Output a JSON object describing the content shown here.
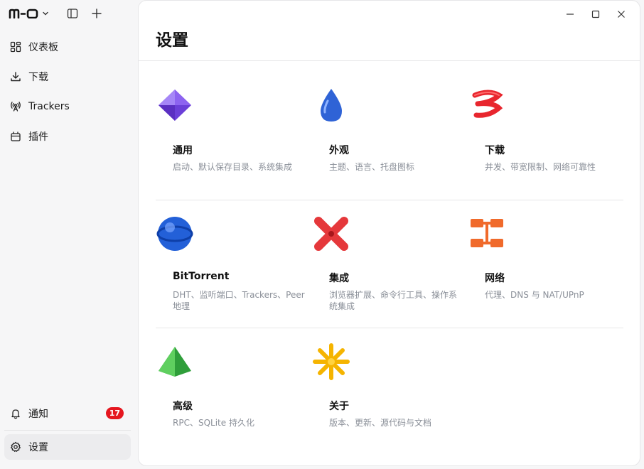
{
  "app": {
    "logo_text": "m-o"
  },
  "sidebar": {
    "items": [
      {
        "label": "仪表板",
        "icon": "dashboard-icon"
      },
      {
        "label": "下载",
        "icon": "download-icon"
      },
      {
        "label": "Trackers",
        "icon": "antenna-icon"
      },
      {
        "label": "插件",
        "icon": "plugin-icon"
      }
    ],
    "notifications": {
      "label": "通知",
      "icon": "bell-icon",
      "count": "17"
    },
    "settings": {
      "label": "设置",
      "icon": "gear-icon"
    }
  },
  "main": {
    "title": "设置",
    "cards": [
      {
        "title": "通用",
        "desc": "启动、默认保存目录、系统集成",
        "icon": "purple-gem-icon"
      },
      {
        "title": "外观",
        "desc": "主题、语言、托盘图标",
        "icon": "blue-drop-icon"
      },
      {
        "title": "下载",
        "desc": "并发、带宽限制、网络可靠性",
        "icon": "red-coil-icon"
      },
      {
        "title": "BitTorrent",
        "desc": "DHT、监听端口、Trackers、Peer 地理",
        "icon": "blue-sphere-icon"
      },
      {
        "title": "集成",
        "desc": "浏览器扩展、命令行工具、操作系统集成",
        "icon": "red-cross-icon"
      },
      {
        "title": "网络",
        "desc": "代理、DNS 与 NAT/UPnP",
        "icon": "orange-network-icon"
      },
      {
        "title": "高级",
        "desc": "RPC、SQLite 持久化",
        "icon": "green-pyramid-icon"
      },
      {
        "title": "关于",
        "desc": "版本、更新、源代码与文档",
        "icon": "yellow-star-icon"
      }
    ]
  },
  "colors": {
    "badge": "#e5161f",
    "active_bg": "#ececee",
    "muted_text": "#8a8f98"
  }
}
